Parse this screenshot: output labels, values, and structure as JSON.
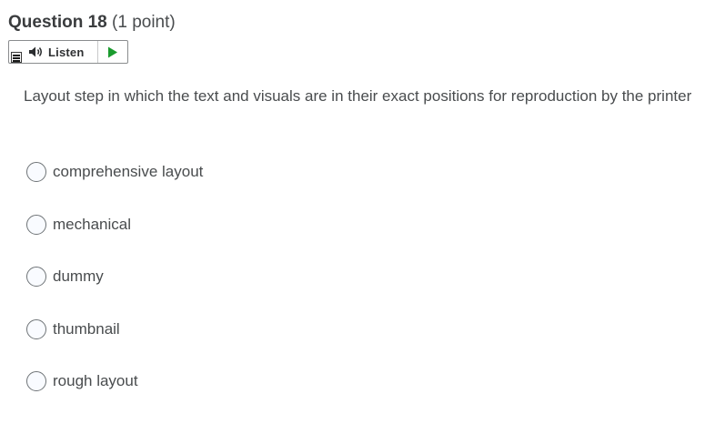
{
  "question": {
    "title": "Question 18",
    "points": "(1 point)"
  },
  "toolbar": {
    "menu_icon": "menu-icon",
    "speaker_icon": "speaker-icon",
    "listen_label": "Listen",
    "play_icon": "play-icon",
    "play_color": "#1a9b2e"
  },
  "prompt": "Layout step in which the text and visuals are in their exact positions for reproduction by the printer",
  "options": [
    {
      "label": "comprehensive layout"
    },
    {
      "label": "mechanical"
    },
    {
      "label": "dummy"
    },
    {
      "label": "thumbnail"
    },
    {
      "label": "rough layout"
    }
  ]
}
